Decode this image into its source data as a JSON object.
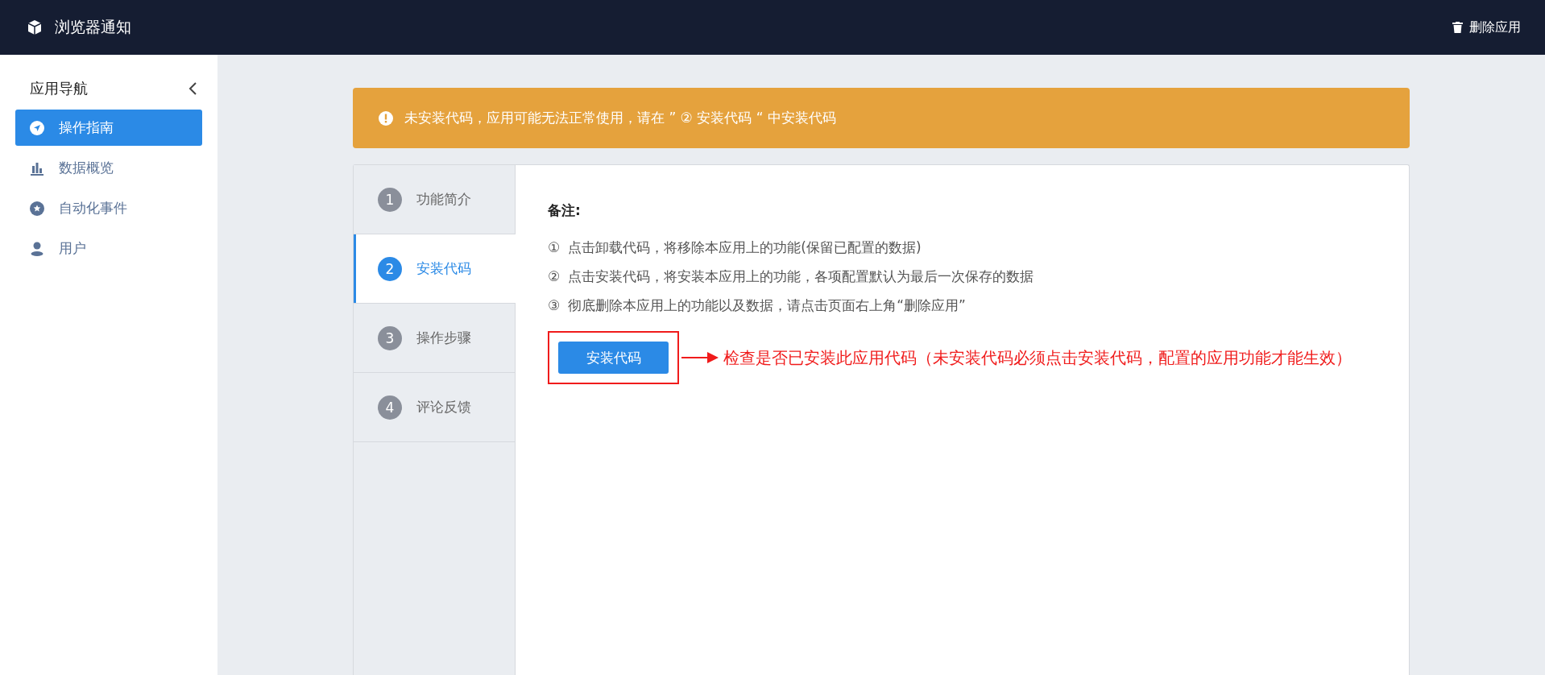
{
  "header": {
    "title": "浏览器通知",
    "action": "删除应用"
  },
  "sidebar": {
    "title": "应用导航",
    "items": [
      {
        "label": "操作指南",
        "selected": true
      },
      {
        "label": "数据概览",
        "selected": false
      },
      {
        "label": "自动化事件",
        "selected": false
      },
      {
        "label": "用户",
        "selected": false
      }
    ]
  },
  "alert": {
    "text": "未安装代码，应用可能无法正常使用，请在 ” ② 安装代码 “ 中安装代码"
  },
  "steps": [
    {
      "number": "1",
      "label": "功能简介",
      "selected": false
    },
    {
      "number": "2",
      "label": "安装代码",
      "selected": true
    },
    {
      "number": "3",
      "label": "操作步骤",
      "selected": false
    },
    {
      "number": "4",
      "label": "评论反馈",
      "selected": false
    }
  ],
  "notes": {
    "title": "备注:",
    "items": [
      {
        "mark": "①",
        "text": "点击卸载代码，将移除本应用上的功能(保留已配置的数据)"
      },
      {
        "mark": "②",
        "text": "点击安装代码，将安装本应用上的功能，各项配置默认为最后一次保存的数据"
      },
      {
        "mark": "③",
        "text": "彻底删除本应用上的功能以及数据，请点击页面右上角“删除应用”"
      }
    ]
  },
  "install_button": "安装代码",
  "annotation": "检查是否已安装此应用代码（未安装代码必须点击安装代码，配置的应用功能才能生效）"
}
